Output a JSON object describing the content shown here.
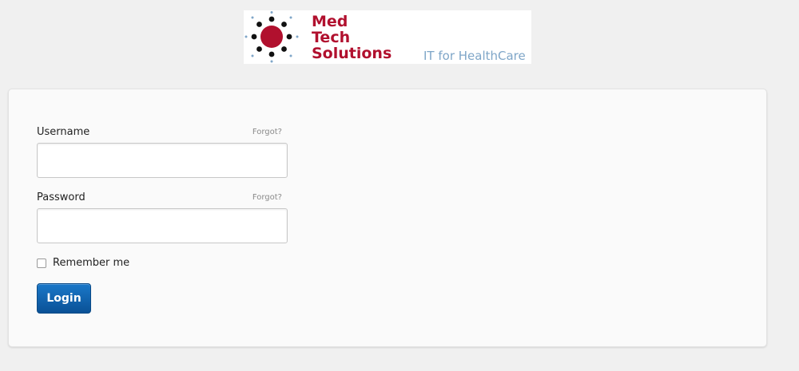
{
  "brand": {
    "line1": "Med",
    "line2": "Tech",
    "line3": "Solutions",
    "tagline": "IT for HealthCare",
    "color_primary": "#b1102e",
    "color_tagline": "#7fa6c8",
    "logo_icon": "sun-dots-logo-icon"
  },
  "form": {
    "username_label": "Username",
    "username_forgot": "Forgot?",
    "username_value": "",
    "password_label": "Password",
    "password_forgot": "Forgot?",
    "password_value": "",
    "remember_label": "Remember me",
    "remember_checked": false,
    "login_label": "Login",
    "login_color": "#0a5196"
  }
}
